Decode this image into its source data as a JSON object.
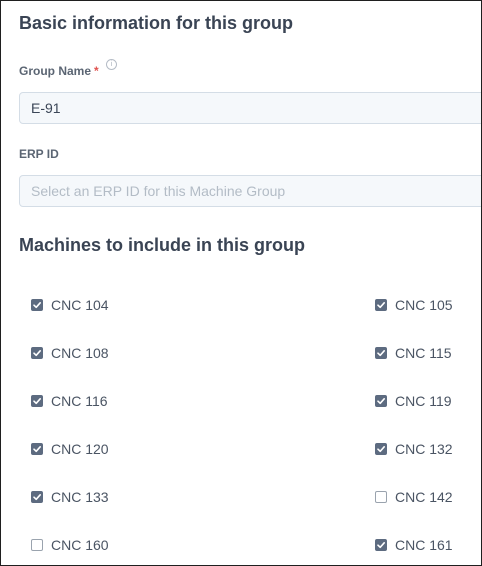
{
  "basic_section": {
    "title": "Basic information for this group"
  },
  "group_name": {
    "label": "Group Name",
    "required_mark": "*",
    "info_icon": "info-icon",
    "value": "E-91"
  },
  "erp_id": {
    "label": "ERP ID",
    "value": "",
    "placeholder": "Select an ERP ID for this Machine Group"
  },
  "machines_section": {
    "title": "Machines to include in this group"
  },
  "machines": [
    {
      "label": "CNC 104",
      "checked": true
    },
    {
      "label": "CNC 105",
      "checked": true
    },
    {
      "label": "CNC 108",
      "checked": true
    },
    {
      "label": "CNC 115",
      "checked": true
    },
    {
      "label": "CNC 116",
      "checked": true
    },
    {
      "label": "CNC 119",
      "checked": true
    },
    {
      "label": "CNC 120",
      "checked": true
    },
    {
      "label": "CNC 132",
      "checked": true
    },
    {
      "label": "CNC 133",
      "checked": true
    },
    {
      "label": "CNC 142",
      "checked": false
    },
    {
      "label": "CNC 160",
      "checked": false
    },
    {
      "label": "CNC 161",
      "checked": true
    }
  ],
  "colors": {
    "checkbox_checked": "#5d6b80",
    "required": "#e0524f",
    "heading": "#3a4454"
  }
}
